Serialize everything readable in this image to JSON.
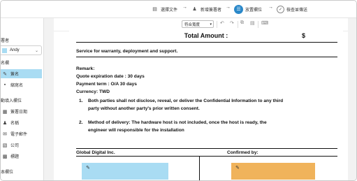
{
  "steps": [
    {
      "icon": "document-icon",
      "label": "選擇文件"
    },
    {
      "icon": "person-icon",
      "label": "新增簽署者"
    },
    {
      "icon": "fields-icon",
      "label": "放置欄位"
    },
    {
      "icon": "check-circle-icon",
      "label": "檢查並傳送"
    }
  ],
  "sidebar": {
    "signer_title": "署者",
    "signer_name": "Andy",
    "signer_color": "#a9dcf3",
    "sign_section": "名欄",
    "sign_items": [
      {
        "icon": "signature-pen-icon",
        "label": "簽名"
      },
      {
        "icon": "initials-icon",
        "label": "縮寫名"
      }
    ],
    "auto_section": "動填入欄位",
    "auto_items": [
      {
        "icon": "calendar-icon",
        "label": "簽署日期"
      },
      {
        "icon": "person-icon",
        "label": "名稱"
      },
      {
        "icon": "email-icon",
        "label": "電子郵件"
      },
      {
        "icon": "building-icon",
        "label": "公司"
      },
      {
        "icon": "title-icon",
        "label": "標題"
      }
    ],
    "basic_section": "本欄位"
  },
  "toolbar": {
    "zoom_value": "符合寬度"
  },
  "document": {
    "total_label": "Total Amount :",
    "total_symbol": "$",
    "service_line": "Service for warranty, deployment and support.",
    "remark": "Remark:",
    "quote_expiration": "Quote expiration date : 30 days",
    "payment_term": "Payment term : O/A 30 days",
    "currency": "Currency: TWD",
    "item1_num": "1.",
    "item1_line1": "Both parties shall not disclose, reveal, or deliver the Confidential Information to any third",
    "item1_line2": "party without another party's prior written consent.",
    "item2_num": "2.",
    "item2_line1": "Method of delivery: The hardware host is not included, once the host is ready, the",
    "item2_line2": "engineer will responsible for the installation",
    "company_left": "Global Digital Inc.",
    "confirmed_by": "Confirmed by:",
    "sig_left_color": "#a9dcf3",
    "sig_right_color": "#f0b35b"
  }
}
